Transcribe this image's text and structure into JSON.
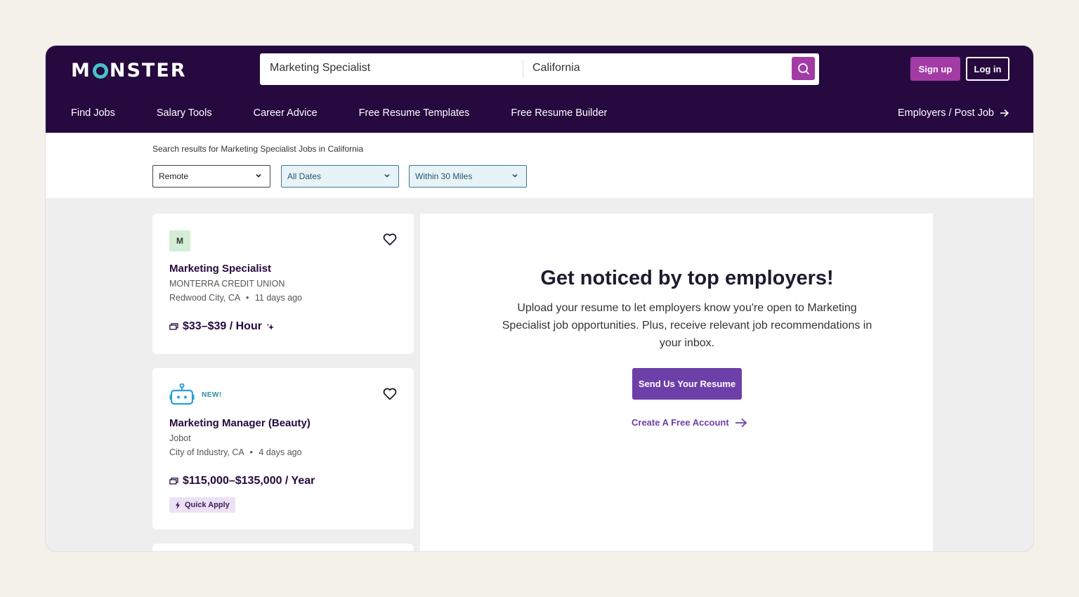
{
  "brand": {
    "logo_pre": "M",
    "logo_post": "NSTER"
  },
  "search": {
    "keyword_value": "Marketing Specialist",
    "location_value": "California"
  },
  "header": {
    "signup_label": "Sign up",
    "login_label": "Log in"
  },
  "nav": {
    "items": [
      "Find Jobs",
      "Salary Tools",
      "Career Advice",
      "Free Resume Templates",
      "Free Resume Builder"
    ],
    "employers_label": "Employers / Post Job"
  },
  "filters": {
    "results_text": "Search results for Marketing Specialist Jobs in California",
    "remote": "Remote",
    "dates": "All Dates",
    "distance": "Within 30 Miles"
  },
  "jobs": [
    {
      "logo_letter": "M",
      "title": "Marketing Specialist",
      "company": "MONTERRA CREDIT UNION",
      "location": "Redwood City, CA",
      "age": "11 days ago",
      "salary": "$33–$39 / Hour"
    },
    {
      "badge": "NEW!",
      "title": "Marketing Manager (Beauty)",
      "company": "Jobot",
      "location": "City of Industry, CA",
      "age": "4 days ago",
      "salary": "$115,000–$135,000 / Year",
      "quick_apply": "Quick Apply"
    }
  ],
  "promo": {
    "heading": "Get noticed by top employers!",
    "body": "Upload your resume to let employers know you're open to Marketing Specialist job opportunities. Plus, receive relevant job recommendations in your inbox.",
    "button": "Send Us Your Resume",
    "link": "Create A Free Account"
  },
  "colors": {
    "header_bg": "#25093f",
    "accent": "#a33ba5",
    "primary_button": "#6e3fa9",
    "filter_teal": "#27586c"
  }
}
